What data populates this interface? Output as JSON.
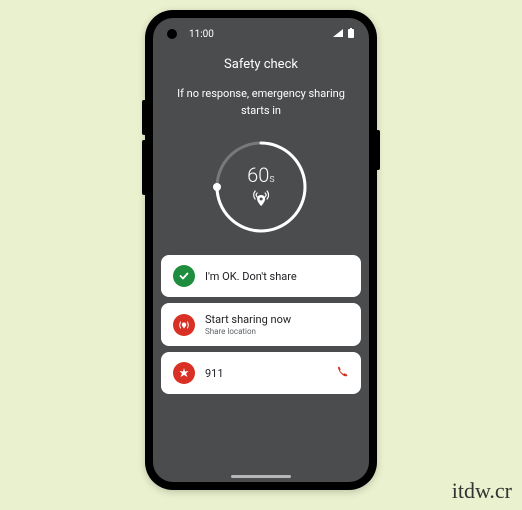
{
  "status_bar": {
    "time": "11:00"
  },
  "header": {
    "title": "Safety check",
    "subtitle": "If no response, emergency sharing starts in"
  },
  "countdown": {
    "value": "60",
    "unit": "s"
  },
  "actions": {
    "ok": {
      "label": "I'm OK. Don't share"
    },
    "share": {
      "label": "Start sharing now",
      "sublabel": "Share location"
    },
    "emergency": {
      "label": "911"
    }
  },
  "watermark": "itdw.cr",
  "colors": {
    "bg": "#eaf1cf",
    "phone_bg": "#4a4c4e",
    "green": "#1e8e3e",
    "red": "#d93025"
  }
}
